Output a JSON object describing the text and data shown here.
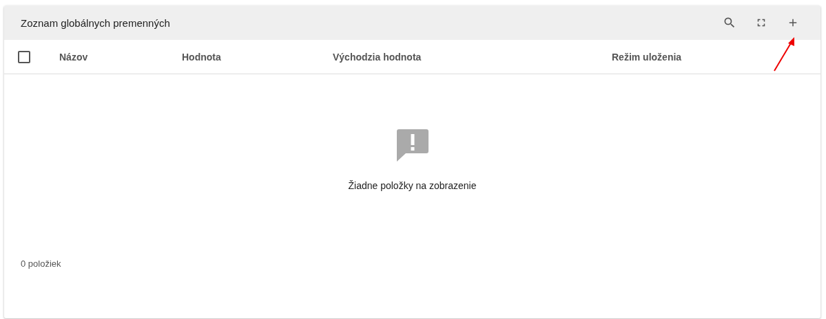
{
  "panel": {
    "title": "Zoznam globálnych premenných"
  },
  "table": {
    "select_all": {
      "checked": false
    },
    "columns": [
      "Názov",
      "Hodnota",
      "Východzia hodnota",
      "Režim uloženia"
    ],
    "empty_message": "Žiadne položky na zobrazenie"
  },
  "footer": {
    "count": "0 položiek"
  }
}
